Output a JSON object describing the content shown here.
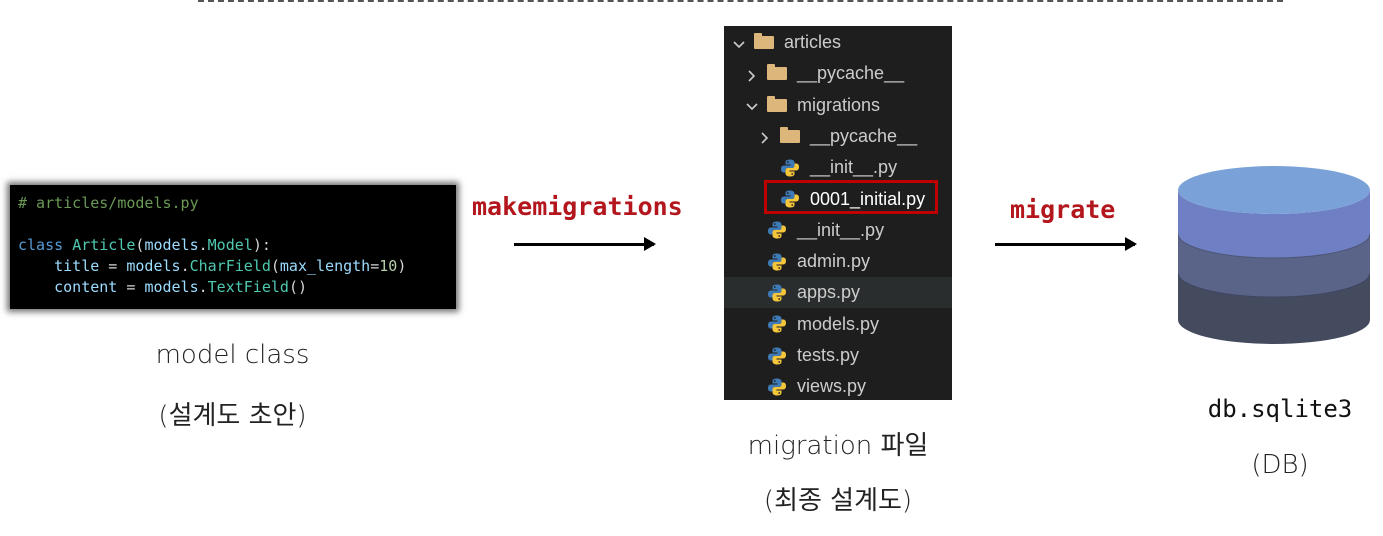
{
  "code": {
    "comment": "# articles/models.py",
    "line2": [
      {
        "t": "class ",
        "c": "kw"
      },
      {
        "t": "Article",
        "c": "cls"
      },
      {
        "t": "(",
        "c": "p"
      },
      {
        "t": "models",
        "c": "id"
      },
      {
        "t": ".",
        "c": "p"
      },
      {
        "t": "Model",
        "c": "cls"
      },
      {
        "t": "):",
        "c": "p"
      }
    ],
    "line3": [
      {
        "t": "    title",
        "c": "id"
      },
      {
        "t": " = ",
        "c": "p"
      },
      {
        "t": "models",
        "c": "id"
      },
      {
        "t": ".",
        "c": "p"
      },
      {
        "t": "CharField",
        "c": "fn"
      },
      {
        "t": "(",
        "c": "p"
      },
      {
        "t": "max_length",
        "c": "id"
      },
      {
        "t": "=",
        "c": "p"
      },
      {
        "t": "10",
        "c": "num"
      },
      {
        "t": ")",
        "c": "p"
      }
    ],
    "line4": [
      {
        "t": "    content",
        "c": "id"
      },
      {
        "t": " = ",
        "c": "p"
      },
      {
        "t": "models",
        "c": "id"
      },
      {
        "t": ".",
        "c": "p"
      },
      {
        "t": "TextField",
        "c": "fn"
      },
      {
        "t": "()",
        "c": "p"
      }
    ]
  },
  "captions": {
    "model_title": "model class",
    "model_sub": "(설계도 초안)",
    "migration_title": "migration 파일",
    "migration_sub": "(최종 설계도)",
    "db_title": "db.sqlite3",
    "db_sub": "(DB)"
  },
  "ops": {
    "makemigrations": "makemigrations",
    "migrate": "migrate"
  },
  "explorer": {
    "items": [
      {
        "label": "articles",
        "kind": "folder",
        "expanded": true,
        "indent": 0
      },
      {
        "label": "__pycache__",
        "kind": "folder",
        "expanded": false,
        "indent": 1
      },
      {
        "label": "migrations",
        "kind": "folder",
        "expanded": true,
        "indent": 1
      },
      {
        "label": "__pycache__",
        "kind": "folder",
        "expanded": false,
        "indent": 2
      },
      {
        "label": "__init__.py",
        "kind": "py",
        "indent": 2
      },
      {
        "label": "0001_initial.py",
        "kind": "py",
        "indent": 2,
        "selected": true
      },
      {
        "label": "__init__.py",
        "kind": "py",
        "indent": 1
      },
      {
        "label": "admin.py",
        "kind": "py",
        "indent": 1
      },
      {
        "label": "apps.py",
        "kind": "py",
        "indent": 1,
        "hover": true
      },
      {
        "label": "models.py",
        "kind": "py",
        "indent": 1
      },
      {
        "label": "tests.py",
        "kind": "py",
        "indent": 1
      },
      {
        "label": "views.py",
        "kind": "py",
        "indent": 1
      }
    ]
  },
  "colors": {
    "op_label": "#b3161c",
    "selection_border": "#c00000",
    "db_top": "#7aa2d8",
    "db_band1": "#6f7fc4",
    "db_band2": "#5a6488",
    "db_band3": "#454b5e"
  }
}
